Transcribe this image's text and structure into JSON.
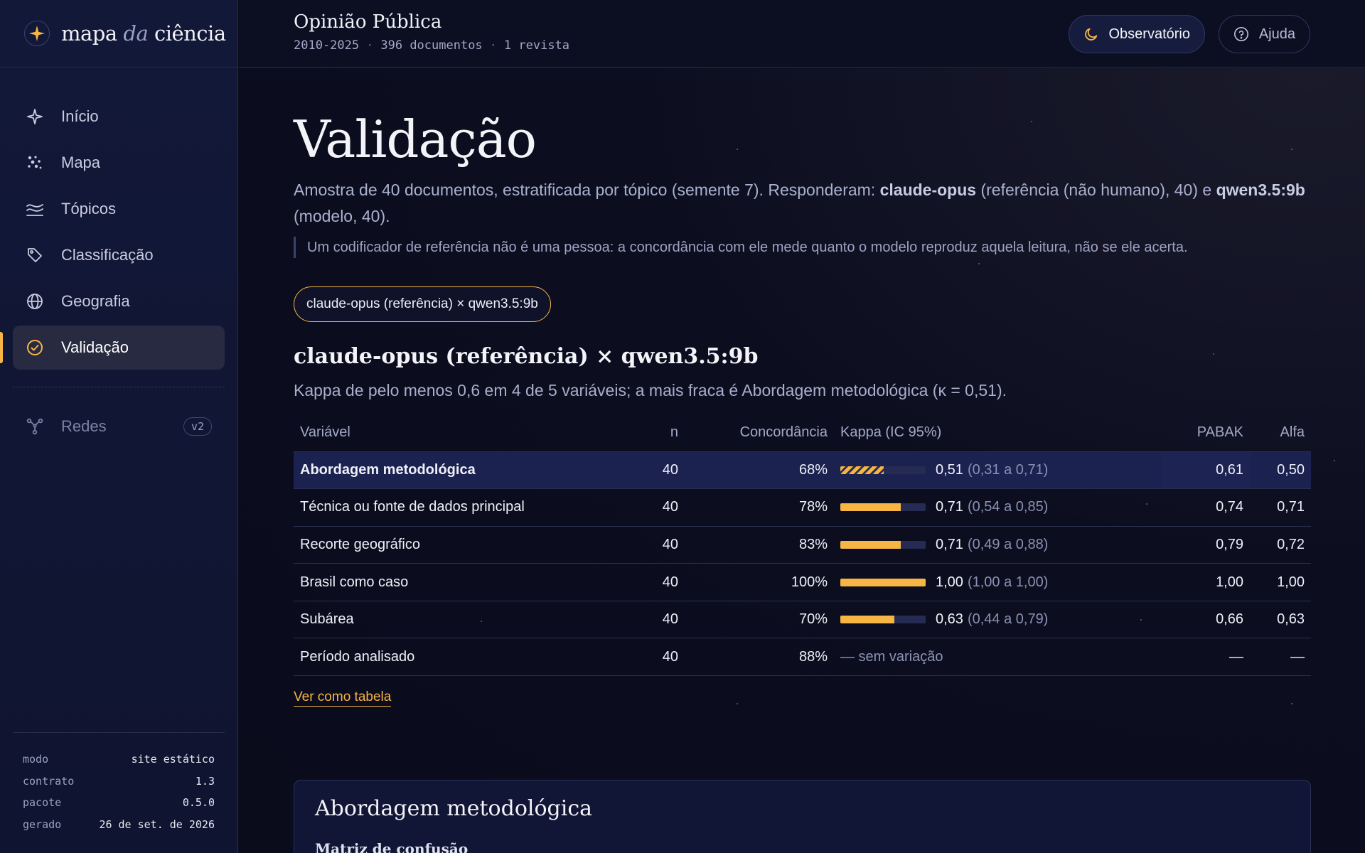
{
  "brand": {
    "name_a": "mapa ",
    "name_b": "da",
    "name_c": " ciência"
  },
  "nav": {
    "items": [
      {
        "label": "Início",
        "icon": "sparkle-icon"
      },
      {
        "label": "Mapa",
        "icon": "scatter-dots-icon"
      },
      {
        "label": "Tópicos",
        "icon": "layers-waves-icon"
      },
      {
        "label": "Classificação",
        "icon": "tag-icon"
      },
      {
        "label": "Geografia",
        "icon": "globe-icon"
      },
      {
        "label": "Validação",
        "icon": "check-circle-icon",
        "active": true
      }
    ],
    "disabled_item": {
      "label": "Redes",
      "badge": "v2",
      "icon": "network-icon"
    }
  },
  "meta": [
    {
      "k": "modo",
      "v": "site estático"
    },
    {
      "k": "contrato",
      "v": "1.3"
    },
    {
      "k": "pacote",
      "v": "0.5.0"
    },
    {
      "k": "gerado",
      "v": "26 de set. de 2026"
    }
  ],
  "header": {
    "title": "Opinião Pública",
    "period": "2010-2025",
    "docs": "396 documentos",
    "journals": "1 revista",
    "observatory_label": "Observatório",
    "help_label": "Ajuda"
  },
  "page": {
    "title": "Validação",
    "intro_a": "Amostra de 40 documentos, estratificada por tópico (semente 7). Responderam: ",
    "intro_b": "claude-opus",
    "intro_c": " (referência (não humano), 40) e ",
    "intro_d": "qwen3.5:9b",
    "intro_e": " (modelo, 40).",
    "note": "Um codificador de referência não é uma pessoa: a concordância com ele mede quanto o modelo reproduz aquela leitura, não se ele acerta.",
    "chip": "claude-opus (referência) × qwen3.5:9b",
    "section_title": "claude-opus (referência) × qwen3.5:9b",
    "section_sub": "Kappa de pelo menos 0,6 em 4 de 5 variáveis; a mais fraca é Abordagem metodológica (κ = 0,51).",
    "table_link": "Ver como tabela",
    "card_title": "Abordagem metodológica",
    "card_sub": "Matriz de confusão"
  },
  "table": {
    "headers": {
      "var": "Variável",
      "n": "n",
      "agree": "Concordância",
      "kappa": "Kappa (IC 95%)",
      "pabak": "PABAK",
      "alpha": "Alfa"
    },
    "rows": [
      {
        "var": "Abordagem metodológica",
        "n": "40",
        "agree": "68%",
        "kappa_value": 0.51,
        "kappa": "0,51",
        "ci": "(0,31 a 0,71)",
        "pabak": "0,61",
        "alpha": "0,50",
        "weakest": true
      },
      {
        "var": "Técnica ou fonte de dados principal",
        "n": "40",
        "agree": "78%",
        "kappa_value": 0.71,
        "kappa": "0,71",
        "ci": "(0,54 a 0,85)",
        "pabak": "0,74",
        "alpha": "0,71"
      },
      {
        "var": "Recorte geográfico",
        "n": "40",
        "agree": "83%",
        "kappa_value": 0.71,
        "kappa": "0,71",
        "ci": "(0,49 a 0,88)",
        "pabak": "0,79",
        "alpha": "0,72"
      },
      {
        "var": "Brasil como caso",
        "n": "40",
        "agree": "100%",
        "kappa_value": 1.0,
        "kappa": "1,00",
        "ci": "(1,00 a 1,00)",
        "pabak": "1,00",
        "alpha": "1,00"
      },
      {
        "var": "Subárea",
        "n": "40",
        "agree": "70%",
        "kappa_value": 0.63,
        "kappa": "0,63",
        "ci": "(0,44 a 0,79)",
        "pabak": "0,66",
        "alpha": "0,63"
      },
      {
        "var": "Período analisado",
        "n": "40",
        "agree": "88%",
        "kappa_value": null,
        "no_variation": "— sem variação",
        "pabak": "—",
        "alpha": "—"
      }
    ]
  },
  "colors": {
    "accent": "#f7b544",
    "bg": "#0b0d1c",
    "sidebar": "#121838",
    "highlight_row": "#1b2250"
  }
}
